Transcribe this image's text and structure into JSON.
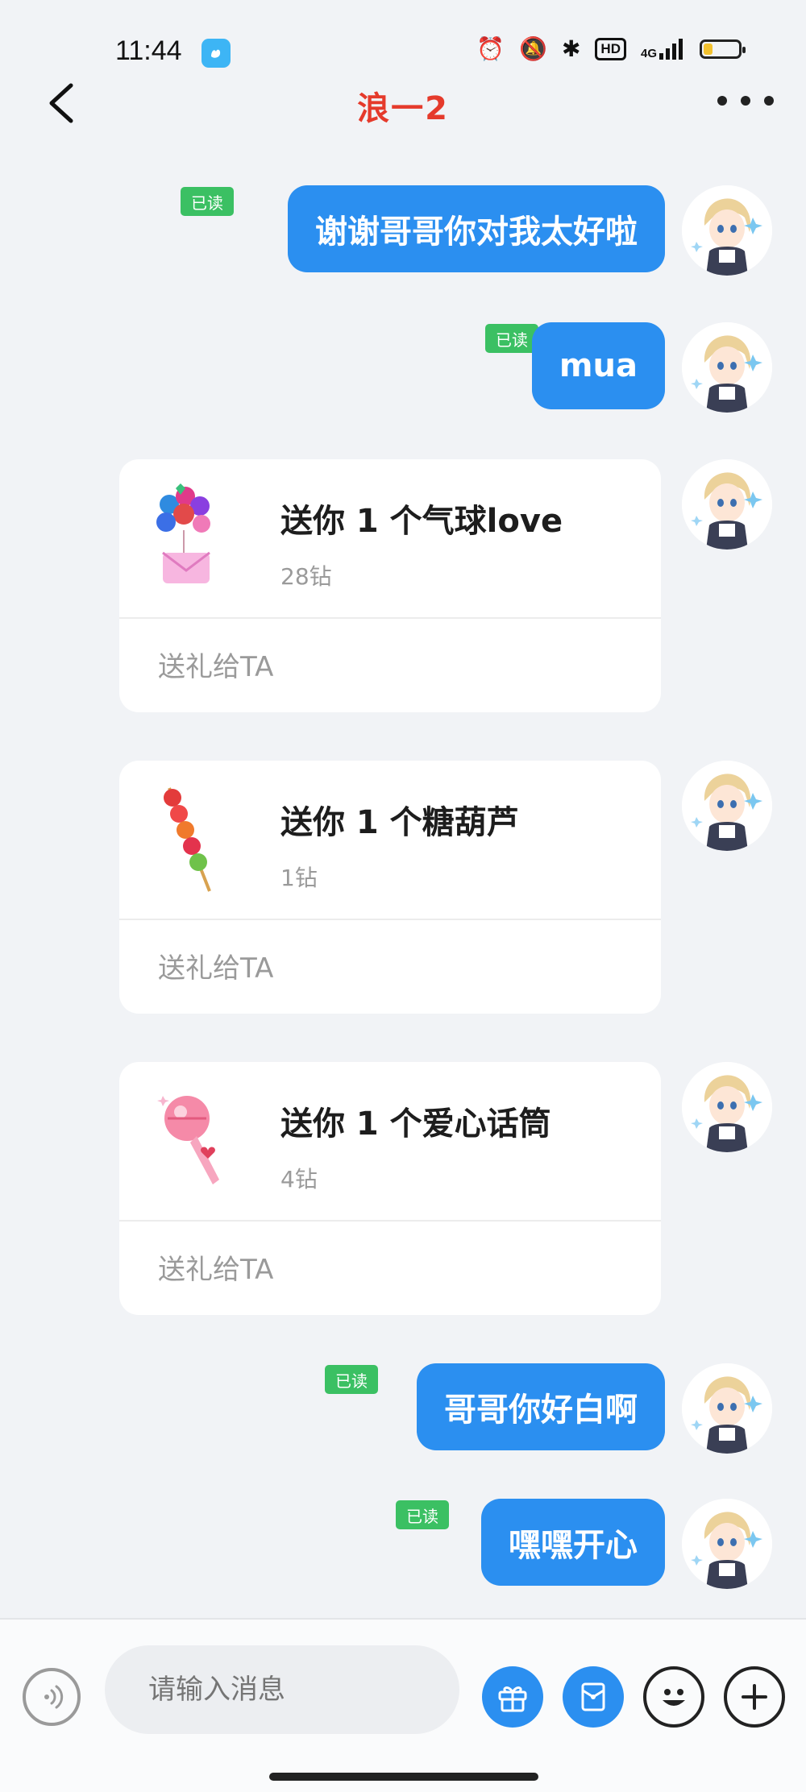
{
  "status_bar": {
    "time": "11:44",
    "icons": [
      "alarm-icon",
      "mute-icon",
      "bluetooth-icon",
      "hd-icon",
      "signal-4g-icon",
      "battery-icon"
    ],
    "hd_label": "HD",
    "network_label": "4G",
    "battery_level": 0.25
  },
  "header": {
    "title": "浪一2",
    "title_color": "#e53a2b"
  },
  "accent_color": "#2b8ff0",
  "read_tag_color": "#3bc063",
  "messages": [
    {
      "type": "text",
      "text": "谢谢哥哥你对我太好啦",
      "status": "已读"
    },
    {
      "type": "text",
      "text": "mua",
      "status": "已读"
    },
    {
      "type": "gift",
      "title": "送你 1 个气球love",
      "price": "28钻",
      "action": "送礼给TA",
      "icon": "balloon-gift-icon"
    },
    {
      "type": "gift",
      "title": "送你 1 个糖葫芦",
      "price": "1钻",
      "action": "送礼给TA",
      "icon": "candied-haws-gift-icon"
    },
    {
      "type": "gift",
      "title": "送你 1 个爱心话筒",
      "price": "4钻",
      "action": "送礼给TA",
      "icon": "heart-microphone-gift-icon"
    },
    {
      "type": "text",
      "text": "哥哥你好白啊",
      "status": "已读"
    },
    {
      "type": "text",
      "text": "嘿嘿开心",
      "status": "已读"
    }
  ],
  "composer": {
    "placeholder": "请输入消息",
    "buttons": [
      "voice-icon",
      "gift-icon",
      "red-packet-icon",
      "emoji-icon",
      "plus-icon"
    ]
  }
}
